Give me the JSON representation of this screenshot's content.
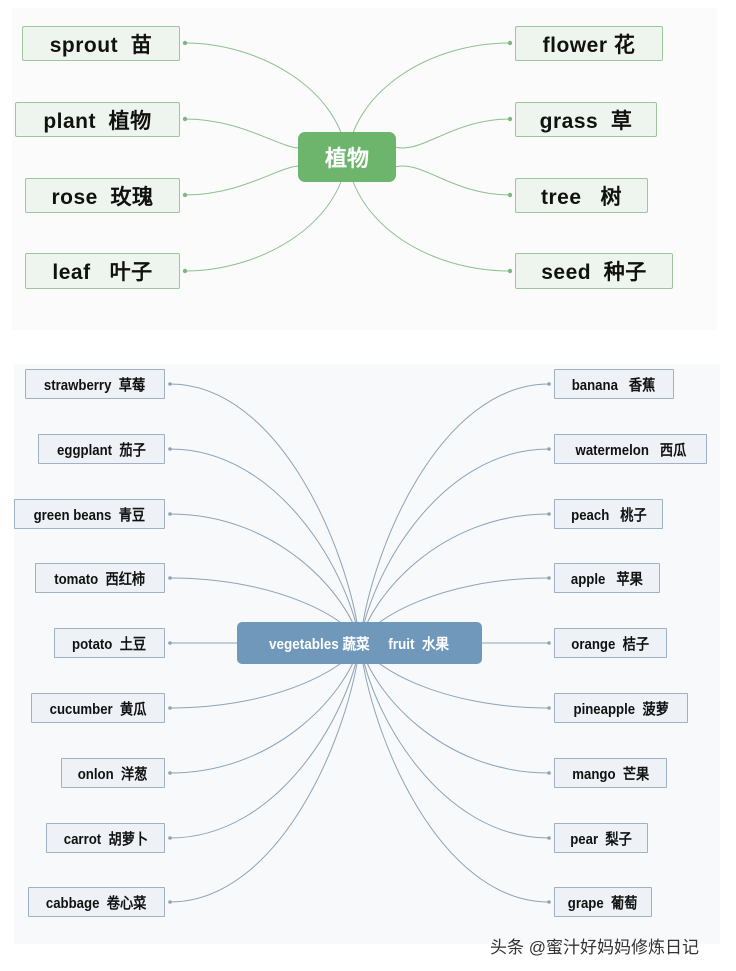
{
  "colors": {
    "plant_center": "#6db56d",
    "plant_node_bg": "#eef5ee",
    "plant_node_border": "#9cc79c",
    "plant_link": "#8fbf8f",
    "fv_center": "#6f98ba",
    "fv_node_bg": "#eef2f6",
    "fv_node_border": "#9fb1c3",
    "fv_link": "#8ea3b5"
  },
  "plants_map": {
    "center": "植物",
    "left": [
      {
        "en": "sprout",
        "zh": "苗",
        "label": "sprout  苗"
      },
      {
        "en": "plant",
        "zh": "植物",
        "label": "plant  植物"
      },
      {
        "en": "rose",
        "zh": "玫瑰",
        "label": "rose  玫瑰"
      },
      {
        "en": "leaf",
        "zh": "叶子",
        "label": "leaf   叶子"
      }
    ],
    "right": [
      {
        "en": "flower",
        "zh": "花",
        "label": "flower 花"
      },
      {
        "en": "grass",
        "zh": "草",
        "label": "grass  草"
      },
      {
        "en": "tree",
        "zh": "树",
        "label": "tree   树"
      },
      {
        "en": "seed",
        "zh": "种子",
        "label": "seed  种子"
      }
    ]
  },
  "food_map": {
    "center": "vegetables 蔬菜     fruit  水果",
    "vegetables": [
      {
        "en": "strawberry",
        "zh": "草莓",
        "label": "strawberry  草莓"
      },
      {
        "en": "eggplant",
        "zh": "茄子",
        "label": "eggplant  茄子"
      },
      {
        "en": "green beans",
        "zh": "青豆",
        "label": "green beans  青豆"
      },
      {
        "en": "tomato",
        "zh": "西红柿",
        "label": "tomato  西红柿"
      },
      {
        "en": "potato",
        "zh": "土豆",
        "label": "potato  土豆"
      },
      {
        "en": "cucumber",
        "zh": "黄瓜",
        "label": "cucumber  黄瓜"
      },
      {
        "en": "onion",
        "zh": "洋葱",
        "label": "onlon  洋葱"
      },
      {
        "en": "carrot",
        "zh": "胡萝卜",
        "label": "carrot  胡萝卜"
      },
      {
        "en": "cabbage",
        "zh": "卷心菜",
        "label": "cabbage  卷心菜"
      }
    ],
    "fruits": [
      {
        "en": "banana",
        "zh": "香蕉",
        "label": "banana   香蕉"
      },
      {
        "en": "watermelon",
        "zh": "西瓜",
        "label": "watermelon   西瓜"
      },
      {
        "en": "peach",
        "zh": "桃子",
        "label": "peach   桃子"
      },
      {
        "en": "apple",
        "zh": "苹果",
        "label": "apple   苹果"
      },
      {
        "en": "orange",
        "zh": "桔子",
        "label": "orange  桔子"
      },
      {
        "en": "pineapple",
        "zh": "菠萝",
        "label": "pineapple  菠萝"
      },
      {
        "en": "mango",
        "zh": "芒果",
        "label": "mango  芒果"
      },
      {
        "en": "pear",
        "zh": "梨子",
        "label": "pear  梨子"
      },
      {
        "en": "grape",
        "zh": "葡萄",
        "label": "grape  葡萄"
      }
    ]
  },
  "watermark": "头条 @蜜汁好妈妈修炼日记"
}
